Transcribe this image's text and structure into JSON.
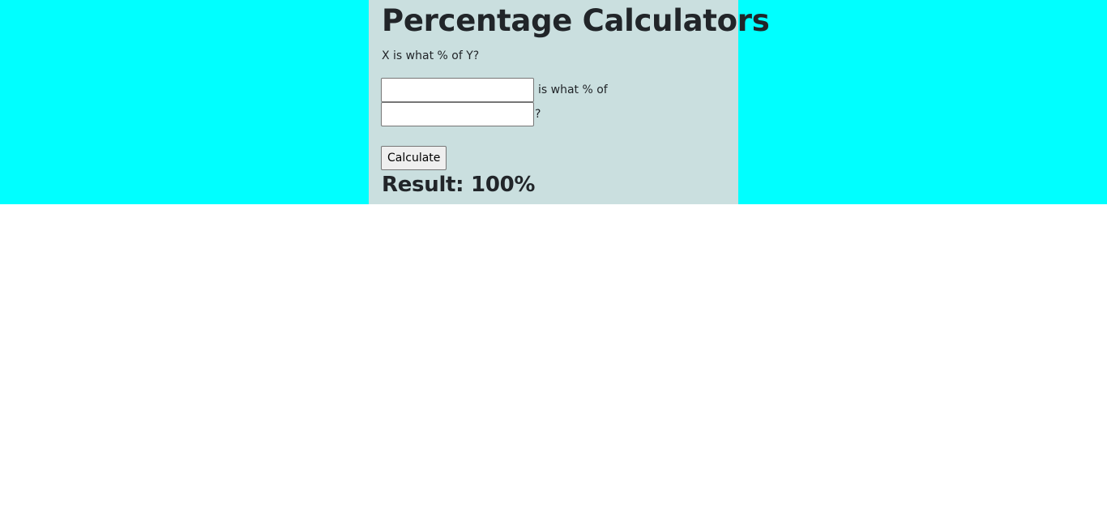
{
  "page": {
    "title": "Percentage Calculators",
    "calculator_heading": "X is what % of Y?"
  },
  "form": {
    "x_value": "",
    "middle_text": "is what % of",
    "y_value": "",
    "end_text": "?",
    "submit_label": "Calculate"
  },
  "result": {
    "text": "Result: 100%"
  },
  "colors": {
    "band": "#00ffff",
    "panel": "#cadfdf",
    "text": "#212529"
  }
}
